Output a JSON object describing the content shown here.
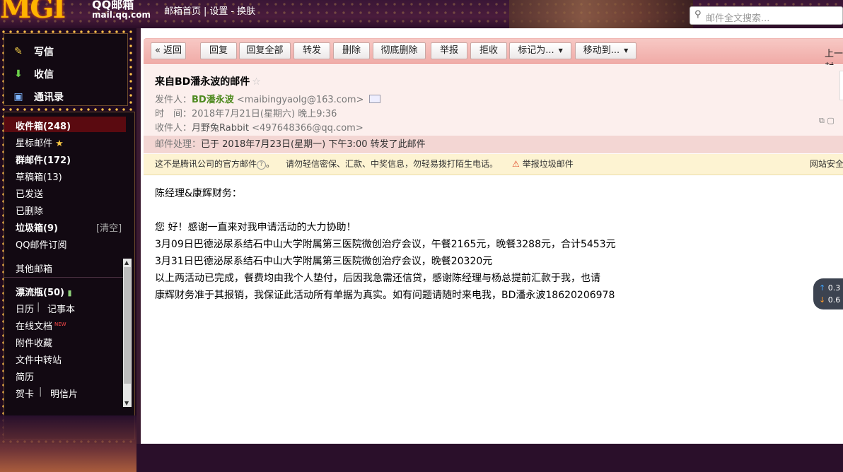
{
  "top": {
    "logo_big": "MGI",
    "logo_qq": "QQ邮箱",
    "logo_domain": "mail.qq.com",
    "links": [
      "邮箱首页",
      "设置",
      "换肤"
    ],
    "search_placeholder": "邮件全文搜索..."
  },
  "quick": [
    {
      "label": "写信",
      "icon": "compose-icon"
    },
    {
      "label": "收信",
      "icon": "receive-icon"
    },
    {
      "label": "通讯录",
      "icon": "contacts-icon"
    }
  ],
  "folders": {
    "inbox": "收件箱(248)",
    "starred": "星标邮件",
    "group": "群邮件(172)",
    "drafts": "草稿箱(13)",
    "sent": "已发送",
    "deleted": "已删除",
    "spam": "垃圾箱(9)",
    "spam_clear": "[清空]",
    "subscribe": "QQ邮件订阅",
    "other": "其他邮箱",
    "drift": "漂流瓶(50)",
    "calendar": "日历",
    "notes": "记事本",
    "docs": "在线文档",
    "docs_badge": "NEW",
    "attachments": "附件收藏",
    "transfer": "文件中转站",
    "resume": "简历",
    "cards": "贺卡",
    "postcards": "明信片"
  },
  "toolbar": {
    "back": "« 返回",
    "reply": "回复",
    "reply_all": "回复全部",
    "forward": "转发",
    "delete": "删除",
    "delete_forever": "彻底删除",
    "report": "举报",
    "reject": "拒收",
    "mark_as": "标记为...",
    "move_to": "移动到...",
    "prev": "上一封"
  },
  "mail": {
    "subject": "来自BD潘永波的邮件",
    "from_label": "发件人：",
    "from_name": "BD潘永波",
    "from_addr": "<maibingyaolg@163.com>",
    "time_label": "时　间：",
    "time_value": "2018年7月21日(星期六) 晚上9:36",
    "to_label": "收件人：",
    "to_name": "月野兔Rabbit",
    "to_addr": "<497648366@qq.com>",
    "process_label": "邮件处理：",
    "process_value": "已于 2018年7月23日(星期一) 下午3:00 转发了此邮件",
    "notice_text": "这不是腾讯公司的官方邮件",
    "notice_warn": "请勿轻信密保、汇款、中奖信息，勿轻易拨打陌生电话。",
    "notice_report": "举报垃圾邮件",
    "notice_right": "网站安全",
    "body": [
      "陈经理&康辉财务：",
      "",
      "您 好！感谢一直来对我申请活动的大力协助！",
      "3月09日巴德泌尿系结石中山大学附属第三医院微创治疗会议，午餐2165元，晚餐3288元，合计5453元",
      "3月31日巴德泌尿系结石中山大学附属第三医院微创治疗会议，晚餐20320元",
      "以上两活动已完成，餐费均由我个人垫付，后因我急需还信贷，感谢陈经理与杨总提前汇款于我，也请",
      "康辉财务准于其报销，我保证此活动所有单据为真实。如有问题请随时来电我，BD潘永波18620206978"
    ]
  },
  "widget": {
    "up": "0.3",
    "down": "0.6"
  }
}
